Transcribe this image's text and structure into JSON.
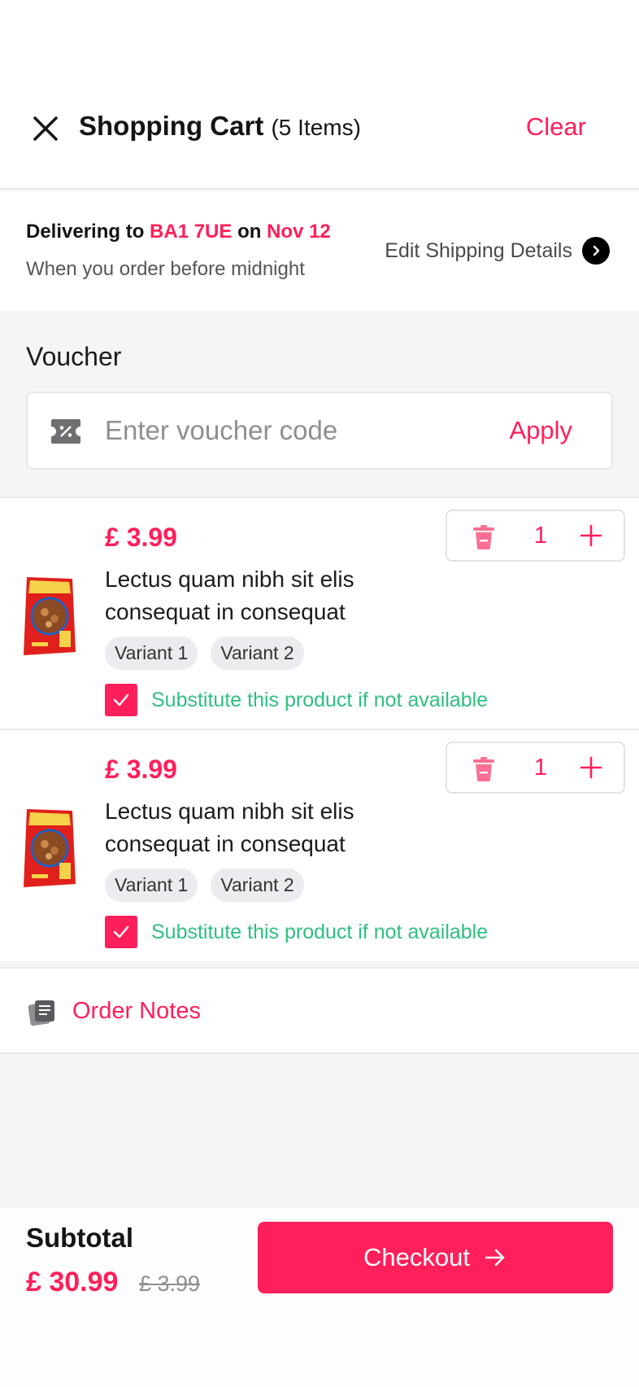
{
  "header": {
    "title": "Shopping Cart",
    "count_label": "(5 Items)",
    "clear_label": "Clear"
  },
  "delivery": {
    "prefix": "Delivering to",
    "postcode": "BA1 7UE",
    "on_label": "on",
    "date": "Nov 12",
    "subtitle": "When you order before midnight",
    "edit_label": "Edit Shipping Details"
  },
  "voucher": {
    "label": "Voucher",
    "placeholder": "Enter voucher code",
    "value": "",
    "apply_label": "Apply"
  },
  "items": [
    {
      "price": "£ 3.99",
      "name": "Lectus quam nibh sit elis consequat in consequat",
      "variants": [
        "Variant 1",
        "Variant 2"
      ],
      "substitute_label": "Substitute this product if not available",
      "substitute_checked": true,
      "quantity": "1"
    },
    {
      "price": "£ 3.99",
      "name": "Lectus quam nibh sit elis consequat in consequat",
      "variants": [
        "Variant 1",
        "Variant 2"
      ],
      "substitute_label": "Substitute this product if not available",
      "substitute_checked": true,
      "quantity": "1"
    }
  ],
  "order_notes": {
    "label": "Order Notes"
  },
  "footer": {
    "subtotal_label": "Subtotal",
    "subtotal_value": "£ 30.99",
    "subtotal_old": "£ 3.99",
    "checkout_label": "Checkout"
  },
  "colors": {
    "accent": "#ff1f5a",
    "success": "#2fbf80",
    "background": "#f5f4f7"
  },
  "icons": {
    "close": "close-icon",
    "edit_shipping": "chevron-right-circle-icon",
    "voucher": "voucher-ticket-icon",
    "delete": "trash-icon",
    "add": "plus-icon",
    "checkbox": "check-icon",
    "notes": "notes-icon",
    "checkout": "arrow-right-icon"
  }
}
